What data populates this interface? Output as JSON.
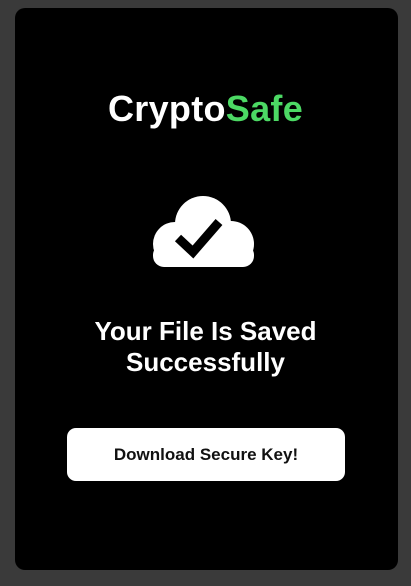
{
  "brand": {
    "name_part1": "Crypto",
    "name_part2": "Safe",
    "accent_color": "#4cd964"
  },
  "status_icon": "cloud-check-icon",
  "message": {
    "line1": "Your File Is Saved",
    "line2": "Successfully"
  },
  "download_button": {
    "label": "Download Secure Key!"
  },
  "colors": {
    "page_background": "#3a3a3a",
    "card_background": "#000000",
    "button_background": "#ffffff"
  }
}
